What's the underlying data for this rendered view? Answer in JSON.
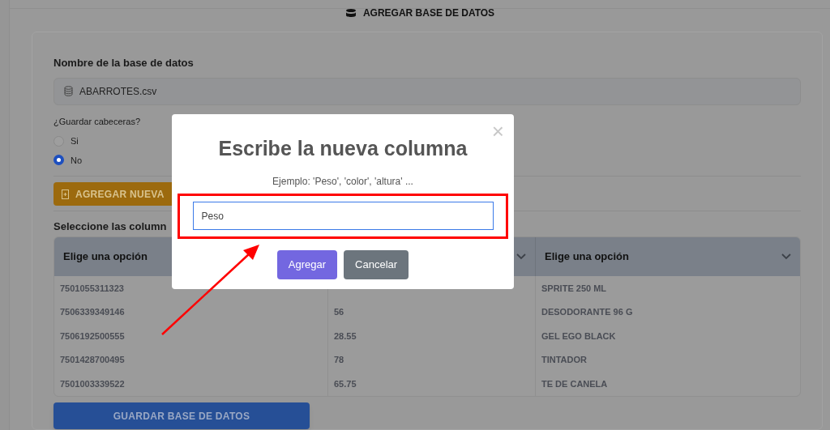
{
  "page_title": "AGREGAR BASE DE DATOS",
  "form": {
    "name_label": "Nombre de la base de datos",
    "name_value": "ABARROTES.csv",
    "headers_question": "¿Guardar cabeceras?",
    "radios": [
      {
        "label": "Si",
        "selected": false
      },
      {
        "label": "No",
        "selected": true
      }
    ],
    "add_button": "AGREGAR NUEVA",
    "columns_label": "Seleccione las column"
  },
  "table": {
    "columns": [
      {
        "label": "Elige una opción"
      },
      {
        "chevron": true
      },
      {
        "label": "Elige una opción",
        "chevron": true
      }
    ],
    "rows": [
      {
        "column_1": "7501055311323",
        "column_3": "SPRITE 250 ML"
      },
      {
        "column_1": "7506339349146",
        "column_2": "56",
        "column_3": "DESODORANTE 96 G"
      },
      {
        "column_1": "7506192500555",
        "column_2": "28.55",
        "column_3": "GEL EGO BLACK"
      },
      {
        "column_1": "7501428700495",
        "column_2": "78",
        "column_3": "TINTADOR"
      },
      {
        "column_1": "7501003339522",
        "column_2": "65.75",
        "column_3": "TE DE CANELA"
      }
    ]
  },
  "save_button": "GUARDAR BASE DE DATOS",
  "modal": {
    "title": "Escribe la nueva columna",
    "hint": "Ejemplo: 'Peso', 'color', 'altura' ...",
    "value": "Peso",
    "close": "×",
    "buttons": [
      {
        "label": "Agregar",
        "kind": "primary"
      },
      {
        "label": "Cancelar",
        "kind": "secondary"
      }
    ]
  }
}
